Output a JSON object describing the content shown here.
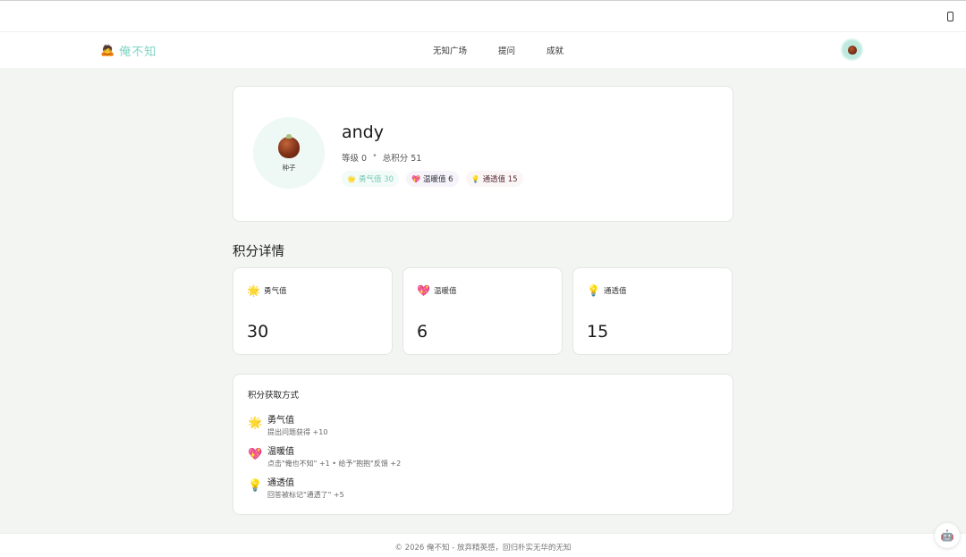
{
  "header": {
    "logo_icon": "🙇",
    "logo_text": "俺不知",
    "nav": [
      "无知广场",
      "提问",
      "成就"
    ]
  },
  "profile": {
    "avatar_caption": "种子",
    "name": "andy",
    "level": "等级 0",
    "separator": "•",
    "total_points": "总积分 51",
    "badges": [
      {
        "icon": "🌟",
        "label": "勇气值 30"
      },
      {
        "icon": "💖",
        "label": "温暖值 6"
      },
      {
        "icon": "💡",
        "label": "通透值 15"
      }
    ]
  },
  "section_title": "积分详情",
  "stats": [
    {
      "icon": "🌟",
      "label": "勇气值",
      "value": "30"
    },
    {
      "icon": "💖",
      "label": "温暖值",
      "value": "6"
    },
    {
      "icon": "💡",
      "label": "通透值",
      "value": "15"
    }
  ],
  "rules": {
    "title": "积分获取方式",
    "items": [
      {
        "icon": "🌟",
        "name": "勇气值",
        "desc": "提出问题获得 +10"
      },
      {
        "icon": "💖",
        "name": "温暖值",
        "desc": "点击\"俺也不知\" +1 • 给予\"抱抱\"反馈 +2"
      },
      {
        "icon": "💡",
        "name": "通透值",
        "desc": "回答被标记\"通透了\" +5"
      }
    ]
  },
  "footer": {
    "text": "© 2026 俺不知 - 放弃精英感，回归朴实无华的无知"
  },
  "chat_icon": "🤖",
  "colors": {
    "accent": "#7fd3c4",
    "background": "#f3f5f3"
  }
}
